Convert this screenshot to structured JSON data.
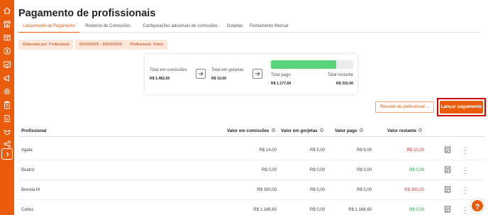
{
  "page": {
    "title": "Pagamento de profissionais"
  },
  "tabs": [
    {
      "label": "Lançamento de Pagamento",
      "active": true
    },
    {
      "label": "Relatório de Comissões"
    },
    {
      "label": "Configurações adicionais de comissões"
    },
    {
      "label": "Gorjetas"
    },
    {
      "label": "Fechamento Mensal"
    }
  ],
  "filters": {
    "order": "Ordenado por: Profissional",
    "date_range": "01/02/2025 - 28/02/2025",
    "professional": "Profissional: Todos"
  },
  "summary": {
    "total_commissions_label": "Total em comissões",
    "total_commissions_value": "R$ 1.482,60",
    "total_tips_label": "Total em gorjetas",
    "total_tips_value": "R$ 10,00",
    "total_paid_label": "Total pago",
    "total_paid_value": "R$ 1.177,60",
    "total_remaining_label": "Total restante",
    "total_remaining_value": "R$ 315,00",
    "paid_fraction": 0.79
  },
  "actions": {
    "summary_button": "Resumo do profissional",
    "launch_button": "Lançar pagamento"
  },
  "table": {
    "headers": {
      "professional": "Profissional",
      "commission": "Valor em comissões",
      "tips": "Valor em gorjetas",
      "paid": "Valor pago",
      "remaining": "Valor restante"
    },
    "rows": [
      {
        "name": "Agata",
        "commission": "R$ 14,00",
        "tips": "R$ 5,00",
        "paid": "R$ 9,00",
        "remaining": "R$ 10,00",
        "status": "red"
      },
      {
        "name": "Beatriz",
        "commission": "R$ 0,00",
        "tips": "R$ 0,00",
        "paid": "R$ 0,00",
        "remaining": "R$ 0,00",
        "status": "green"
      },
      {
        "name": "Brenda M",
        "commission": "R$ 300,00",
        "tips": "R$ 0,00",
        "paid": "R$ 0,00",
        "remaining": "R$ 300,00",
        "status": "red"
      },
      {
        "name": "Carlos",
        "commission": "R$ 1.168,60",
        "tips": "R$ 0,00",
        "paid": "R$ 1.168,60",
        "remaining": "R$ 0,00",
        "status": "green"
      }
    ]
  },
  "help": {
    "label": "?"
  },
  "colors": {
    "accent": "#ea5b0c",
    "highlight_outline": "#d10000",
    "progress": "#5ad37a",
    "negative": "#e0312b",
    "positive": "#16a34a"
  },
  "sidebar": {
    "icons": [
      "home-icon",
      "store-icon",
      "register-icon",
      "money-icon",
      "chart-icon",
      "megaphone-icon",
      "gear-icon",
      "clipboard-icon",
      "doc-icon",
      "handshake-icon",
      "share-icon"
    ]
  }
}
